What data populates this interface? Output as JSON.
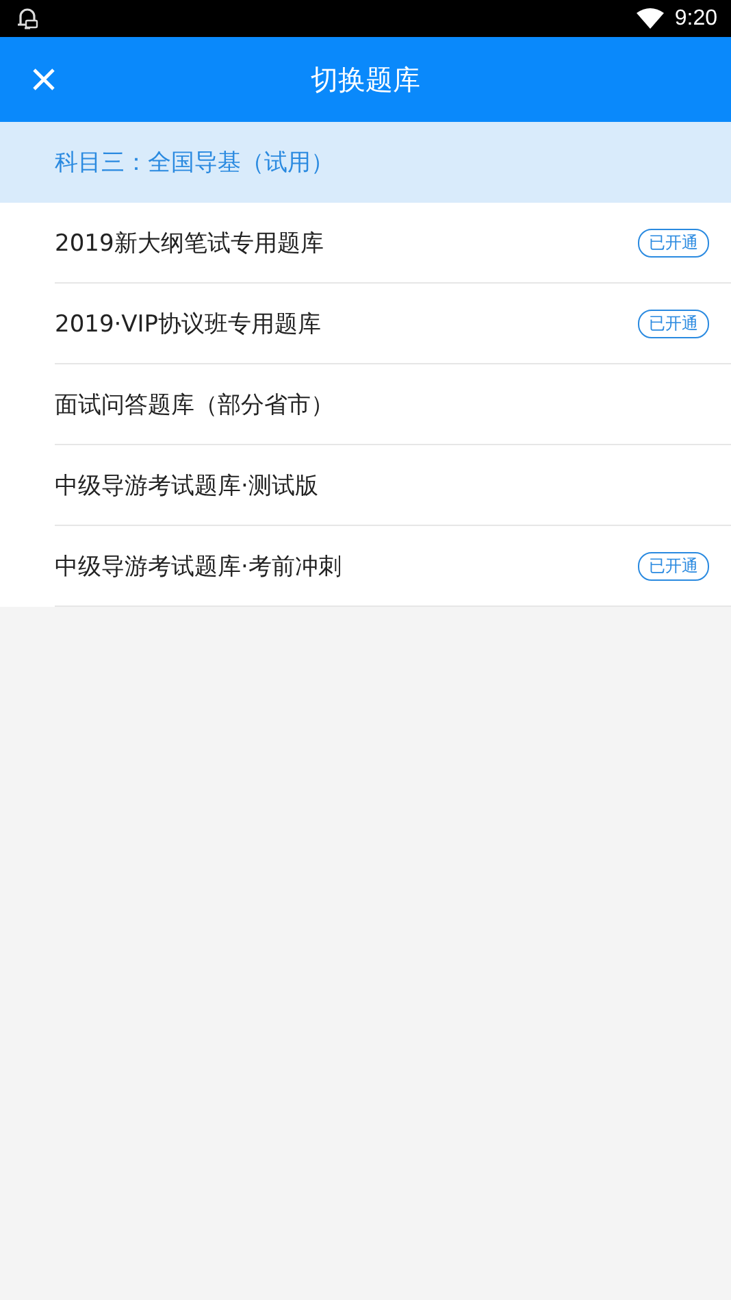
{
  "status_bar": {
    "time": "9:20"
  },
  "header": {
    "title": "切换题库"
  },
  "section": {
    "title": "科目三：全国导基（试用）"
  },
  "items": [
    {
      "label": "2019新大纲笔试专用题库",
      "badge": "已开通"
    },
    {
      "label": "2019·VIP协议班专用题库",
      "badge": "已开通"
    },
    {
      "label": "面试问答题库（部分省市）"
    },
    {
      "label": "中级导游考试题库·测试版"
    },
    {
      "label": "中级导游考试题库·考前冲刺",
      "badge": "已开通"
    }
  ]
}
